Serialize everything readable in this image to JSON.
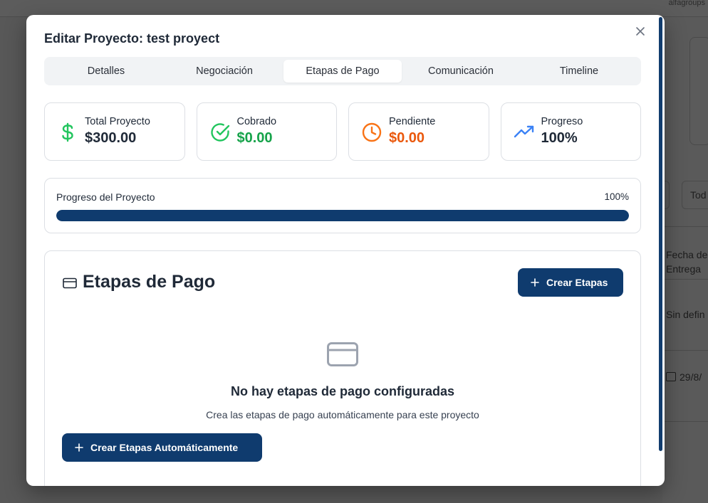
{
  "background": {
    "user_label": "alfagroups",
    "select_label": "Tod",
    "column_header_line1": "Fecha de",
    "column_header_line2": "Entrega",
    "cell_delivery": "Sin defin",
    "cell_date": "29/8/"
  },
  "modal": {
    "title": "Editar Proyecto: test proyect",
    "close_icon": "close-icon"
  },
  "tabs": [
    {
      "label": "Detalles",
      "active": false
    },
    {
      "label": "Negociación",
      "active": false
    },
    {
      "label": "Etapas de Pago",
      "active": true
    },
    {
      "label": "Comunicación",
      "active": false
    },
    {
      "label": "Timeline",
      "active": false
    }
  ],
  "stats": [
    {
      "label": "Total Proyecto",
      "value": "$300.00",
      "icon": "dollar-icon",
      "color": "#1f2937",
      "icon_color": "#22c55e"
    },
    {
      "label": "Cobrado",
      "value": "$0.00",
      "icon": "check-circle-icon",
      "color": "#16a34a",
      "icon_color": "#22c55e"
    },
    {
      "label": "Pendiente",
      "value": "$0.00",
      "icon": "clock-icon",
      "color": "#ea580c",
      "icon_color": "#f97316"
    },
    {
      "label": "Progreso",
      "value": "100%",
      "icon": "trending-up-icon",
      "color": "#1f2937",
      "icon_color": "#3b82f6"
    }
  ],
  "progress": {
    "label": "Progreso del Proyecto",
    "percent_label": "100%",
    "fraction": 1.0,
    "color": "#0f3b6e"
  },
  "stages": {
    "title": "Etapas de Pago",
    "create_button": "Crear Etapas",
    "empty_title": "No hay etapas de pago configuradas",
    "empty_desc": "Crea las etapas de pago automáticamente para este proyecto",
    "auto_button": "Crear Etapas Automáticamente"
  },
  "colors": {
    "primary": "#0f3b6e",
    "border": "#dcdfe4"
  }
}
